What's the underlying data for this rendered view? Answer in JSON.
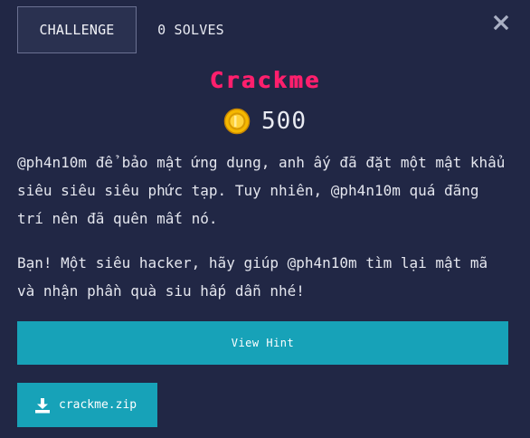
{
  "tabs": [
    {
      "label": "CHALLENGE",
      "active": true
    },
    {
      "label": "0 SOLVES",
      "active": false
    }
  ],
  "challenge": {
    "name": "Crackme",
    "points": "500",
    "description": [
      "@ph4n10m để bảo mật ứng dụng, anh ấy đã đặt một mật khẩu siêu siêu siêu phức tạp. Tuy nhiên, @ph4n10m quá đãng trí nên đã quên mất nó.",
      "Bạn! Một siêu hacker, hãy giúp @ph4n10m tìm lại mật mã và nhận phần quà siu hấp dẫn nhé!"
    ]
  },
  "actions": {
    "hint_label": "View Hint",
    "file_name": "crackme.zip"
  },
  "icons": {
    "close": "close-icon",
    "coin": "coin-icon",
    "download": "download-icon"
  },
  "colors": {
    "background": "#212745",
    "title": "#ff1f6d",
    "button": "#17a2b8",
    "coin": "#f5b800"
  }
}
